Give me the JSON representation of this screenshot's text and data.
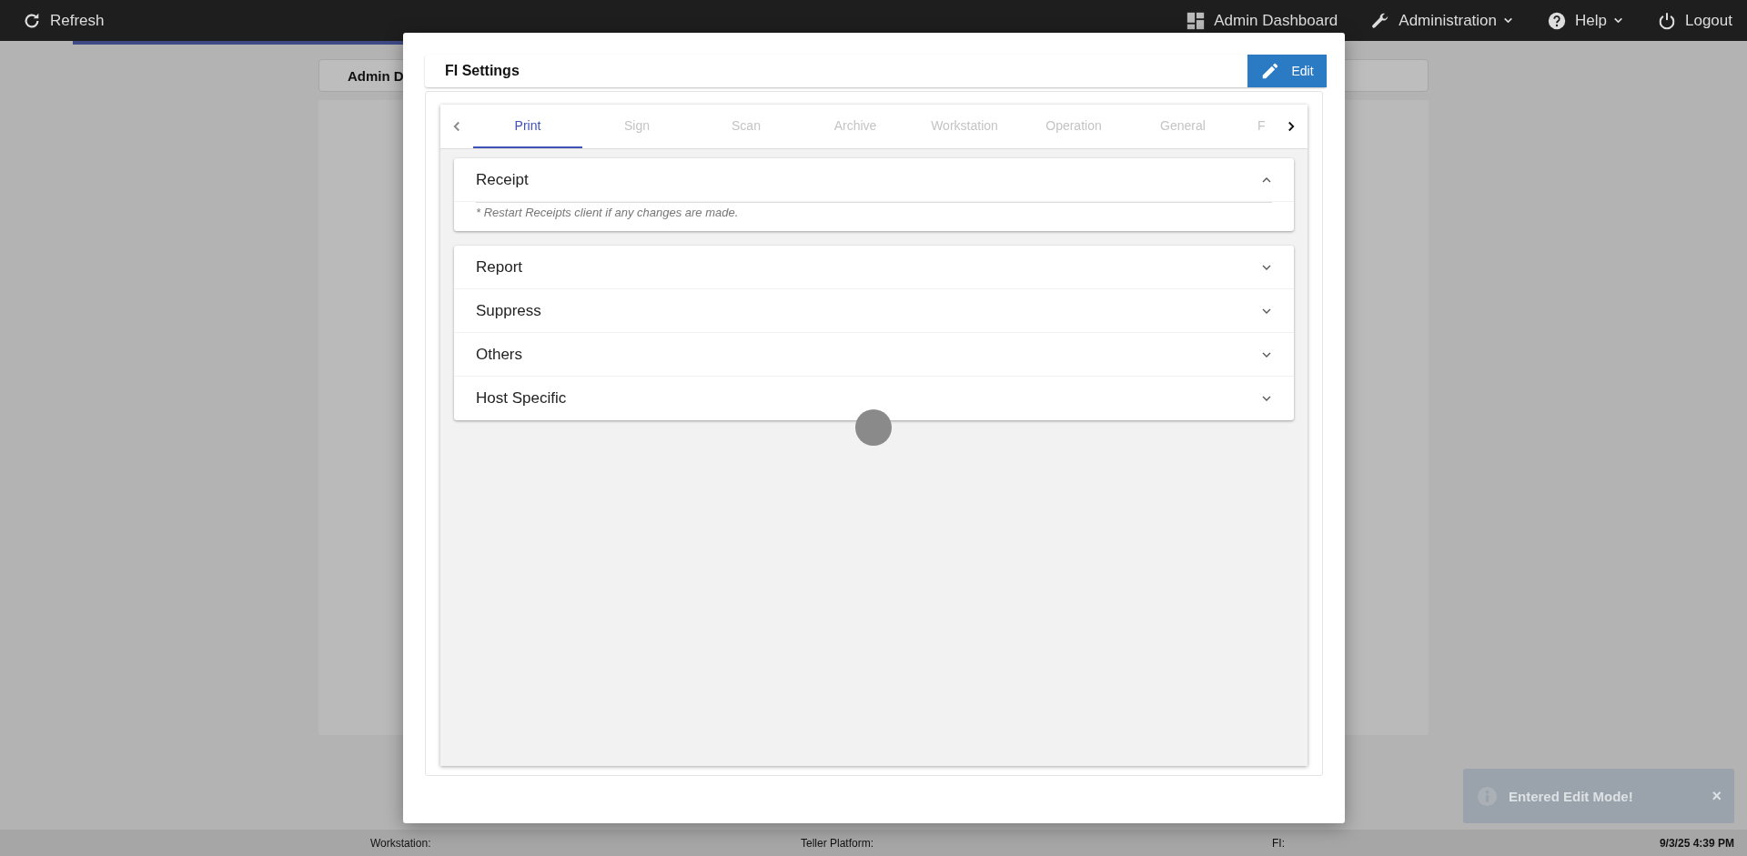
{
  "top_bar": {
    "refresh": "Refresh",
    "links": [
      {
        "label": "Admin Dashboard",
        "dropdown": false
      },
      {
        "label": "Administration",
        "dropdown": true
      },
      {
        "label": "Help",
        "dropdown": true
      },
      {
        "label": "Logout",
        "dropdown": false
      }
    ]
  },
  "background": {
    "tab": "Admin D"
  },
  "dialog": {
    "title": "FI Settings",
    "edit_button": "Edit",
    "tabs": [
      {
        "label": "Print",
        "selected": true
      },
      {
        "label": "Sign",
        "selected": false
      },
      {
        "label": "Scan",
        "selected": false
      },
      {
        "label": "Archive",
        "selected": false
      },
      {
        "label": "Workstation",
        "selected": false
      },
      {
        "label": "Operation",
        "selected": false
      },
      {
        "label": "General",
        "selected": false
      },
      {
        "label": "F",
        "selected": false
      }
    ],
    "sections": [
      {
        "title": "Receipt",
        "expanded": true,
        "note": "* Restart Receipts client if any changes are made."
      },
      {
        "title": "Report",
        "expanded": false
      },
      {
        "title": "Suppress",
        "expanded": false
      },
      {
        "title": "Others",
        "expanded": false
      },
      {
        "title": "Host Specific",
        "expanded": false
      }
    ]
  },
  "toast": {
    "message": "Entered Edit Mode!",
    "close": "×"
  },
  "status_bar": {
    "workstation": "Workstation:",
    "teller_platform": "Teller Platform:",
    "fi": "FI:",
    "time": "9/3/25 4:39 PM"
  }
}
